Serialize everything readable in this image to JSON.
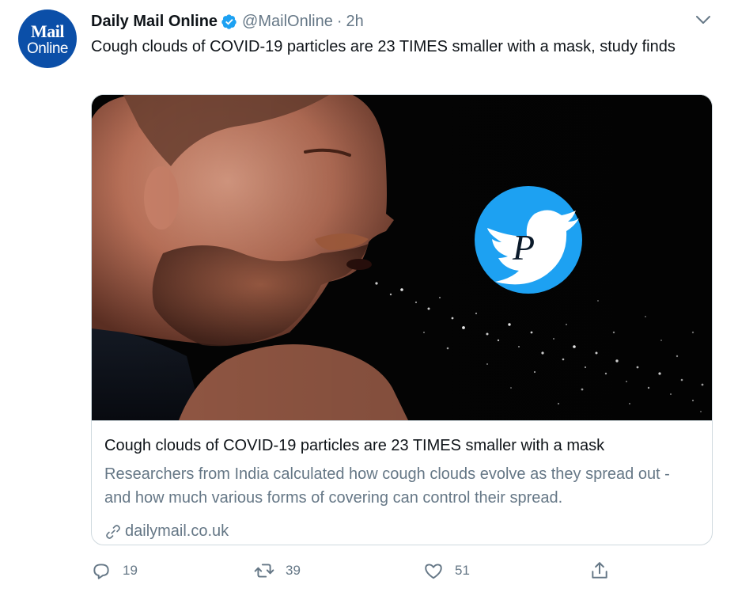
{
  "account": {
    "avatar_line1": "Mail",
    "avatar_line2": "Online",
    "name": "Daily Mail Online",
    "handle": "@MailOnline",
    "separator": "·",
    "time": "2h"
  },
  "tweet": {
    "text": "Cough clouds of COVID-19 particles are 23 TIMES smaller with a mask, study finds"
  },
  "card": {
    "title": "Cough clouds of COVID-19 particles are 23 TIMES smaller with a mask",
    "description": "Researchers from India calculated how cough clouds evolve as they spread out - and how much various forms of covering can control their spread.",
    "domain": "dailymail.co.uk",
    "watermark_letter": "P"
  },
  "actions": {
    "replies": "19",
    "retweets": "39",
    "likes": "51"
  },
  "colors": {
    "avatar_bg": "#0b4fa8",
    "verified": "#1da1f2",
    "muted_text": "#657786",
    "twitter_blue": "#1da1f2"
  },
  "icons": [
    "verified-badge-icon",
    "chevron-down-icon",
    "link-icon",
    "reply-icon",
    "retweet-icon",
    "like-icon",
    "share-icon",
    "twitter-bird-icon"
  ]
}
